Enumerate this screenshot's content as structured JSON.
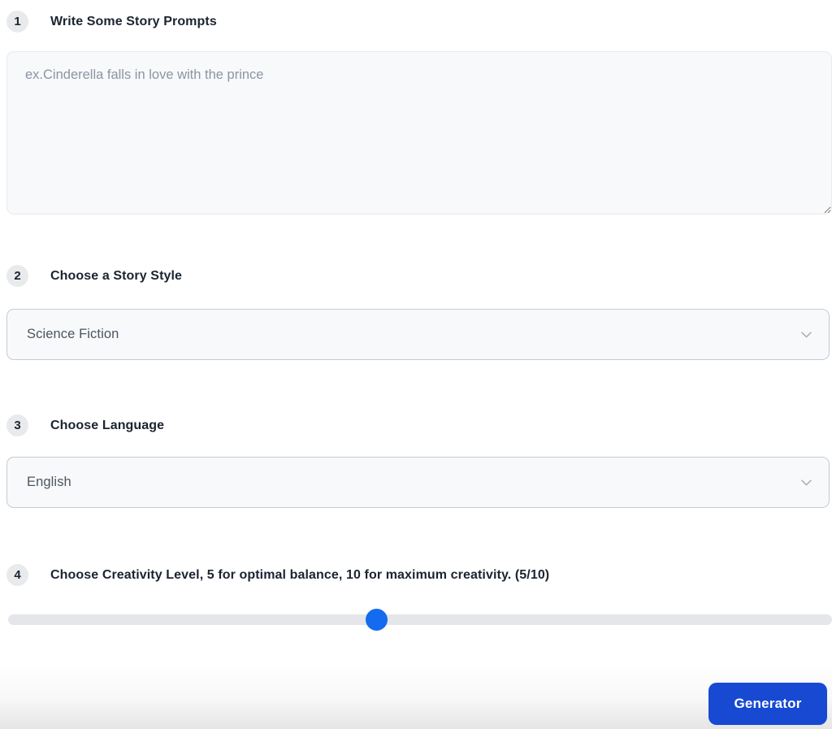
{
  "sections": [
    {
      "number": "1",
      "title": "Write Some Story Prompts"
    },
    {
      "number": "2",
      "title": "Choose a Story Style"
    },
    {
      "number": "3",
      "title": "Choose Language"
    },
    {
      "number": "4",
      "title": "Choose Creativity Level, 5 for optimal balance, 10 for maximum creativity. (5/10)"
    }
  ],
  "prompt": {
    "placeholder": "ex.Cinderella falls in love with the prince",
    "value": ""
  },
  "story_style": {
    "selected": "Science Fiction"
  },
  "language": {
    "selected": "English"
  },
  "creativity": {
    "value": 5,
    "max": 10,
    "display": "5/10"
  },
  "footer": {
    "generator_label": "Generator"
  },
  "colors": {
    "button_blue": "#1749d3",
    "slider_thumb_blue": "#146bef",
    "field_background": "#f8f9fa",
    "badge_background": "#e9eaec",
    "heading_text": "#1b2431",
    "select_text": "#4b5563",
    "placeholder_text": "#8b95a5",
    "select_border": "#c5cbd3",
    "slider_track_gray": "#e4e6e9"
  }
}
